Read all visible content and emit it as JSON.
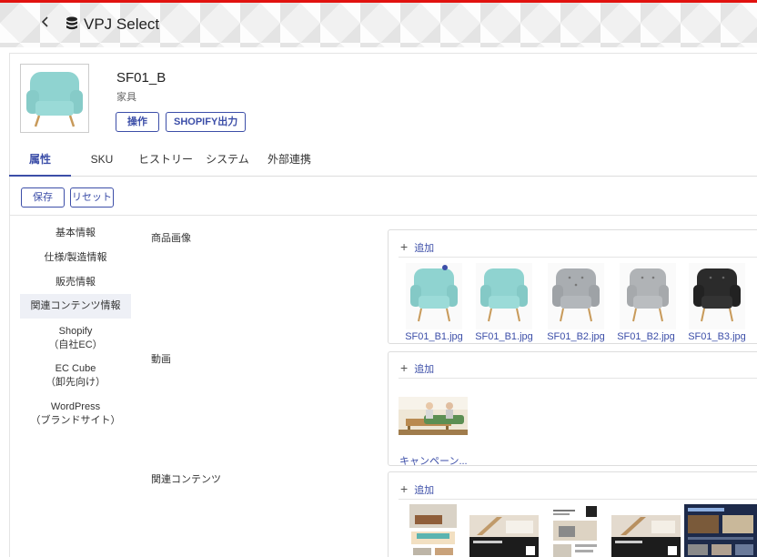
{
  "header": {
    "back_icon": "chevron-left-icon",
    "app_icon": "database-icon",
    "title": "VPJ Select",
    "accent": "#e1120f"
  },
  "product": {
    "name": "SF01_B",
    "category": "家具",
    "action_button": "操作",
    "shopify_button": "SHOPIFY出力"
  },
  "tabs": [
    {
      "label": "属性",
      "active": true
    },
    {
      "label": "SKU"
    },
    {
      "label": "ヒストリー"
    },
    {
      "label": "システム"
    },
    {
      "label": "外部連携"
    }
  ],
  "toolbar": {
    "save_label": "保存",
    "reset_label": "リセット"
  },
  "sidebar": [
    {
      "label": "基本情報"
    },
    {
      "label": "仕様/製造情報"
    },
    {
      "label": "販売情報"
    },
    {
      "label": "関連コンテンツ情報",
      "active": true
    },
    {
      "label": "Shopify",
      "sub": "（自社EC）"
    },
    {
      "label": "EC Cube",
      "sub": "（卸先向け）"
    },
    {
      "label": "WordPress",
      "sub": "（ブランドサイト）"
    }
  ],
  "fields": {
    "images_label": "商品画像",
    "video_label": "動画",
    "related_label": "関連コンテンツ",
    "add_label": "追加",
    "images": [
      {
        "file": "SF01_B1.jpg",
        "color": "#8fd3d0",
        "selected": true
      },
      {
        "file": "SF01_B1.jpg",
        "color": "#8fd3d0"
      },
      {
        "file": "SF01_B2.jpg",
        "color": "#a9adb1"
      },
      {
        "file": "SF01_B2.jpg",
        "color": "#b0b3b6"
      },
      {
        "file": "SF01_B3.jpg",
        "color": "#2b2b2b"
      }
    ],
    "video_caption": "キャンペーン..."
  }
}
